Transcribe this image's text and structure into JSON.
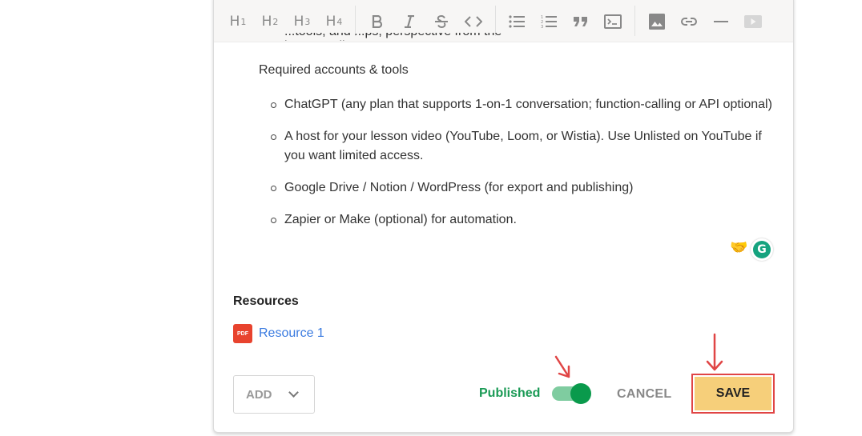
{
  "toolbar": {
    "headings": [
      {
        "label": "H",
        "sub": "1"
      },
      {
        "label": "H",
        "sub": "2"
      },
      {
        "label": "H",
        "sub": "3"
      },
      {
        "label": "H",
        "sub": "4"
      }
    ],
    "tools": [
      "bold-icon",
      "italic-icon",
      "strikethrough-icon",
      "code-icon",
      "bullet-list-icon",
      "numbered-list-icon",
      "quote-icon",
      "code-block-icon",
      "image-icon",
      "link-icon",
      "horizontal-rule-icon",
      "video-icon"
    ]
  },
  "editor": {
    "partial_line": "...tools, and ...ps, perspective from the lesson, ...lly",
    "heading_para": "Required accounts & tools",
    "bullets": [
      "ChatGPT (any plan that supports 1-on-1 conversation; function-calling or API optional)",
      "A host for your lesson video (YouTube, Loom, or Wistia). Use Unlisted on YouTube if you want limited access.",
      "Google Drive / Notion / WordPress (for export and publishing)",
      "Zapier or Make (optional) for automation."
    ],
    "emoji": "🤝",
    "grammarly_letter": "G"
  },
  "resources": {
    "title": "Resources",
    "items": [
      {
        "icon": "pdf-icon",
        "icon_text": "PDF",
        "label": "Resource 1"
      }
    ]
  },
  "footer": {
    "add_label": "ADD",
    "status_label": "Published",
    "published": true,
    "cancel_label": "CANCEL",
    "save_label": "SAVE"
  },
  "colors": {
    "accent_green": "#0a9a4c",
    "save_bg": "#f6cf7a",
    "annotation_red": "#e04545",
    "link_blue": "#3b7be0"
  }
}
